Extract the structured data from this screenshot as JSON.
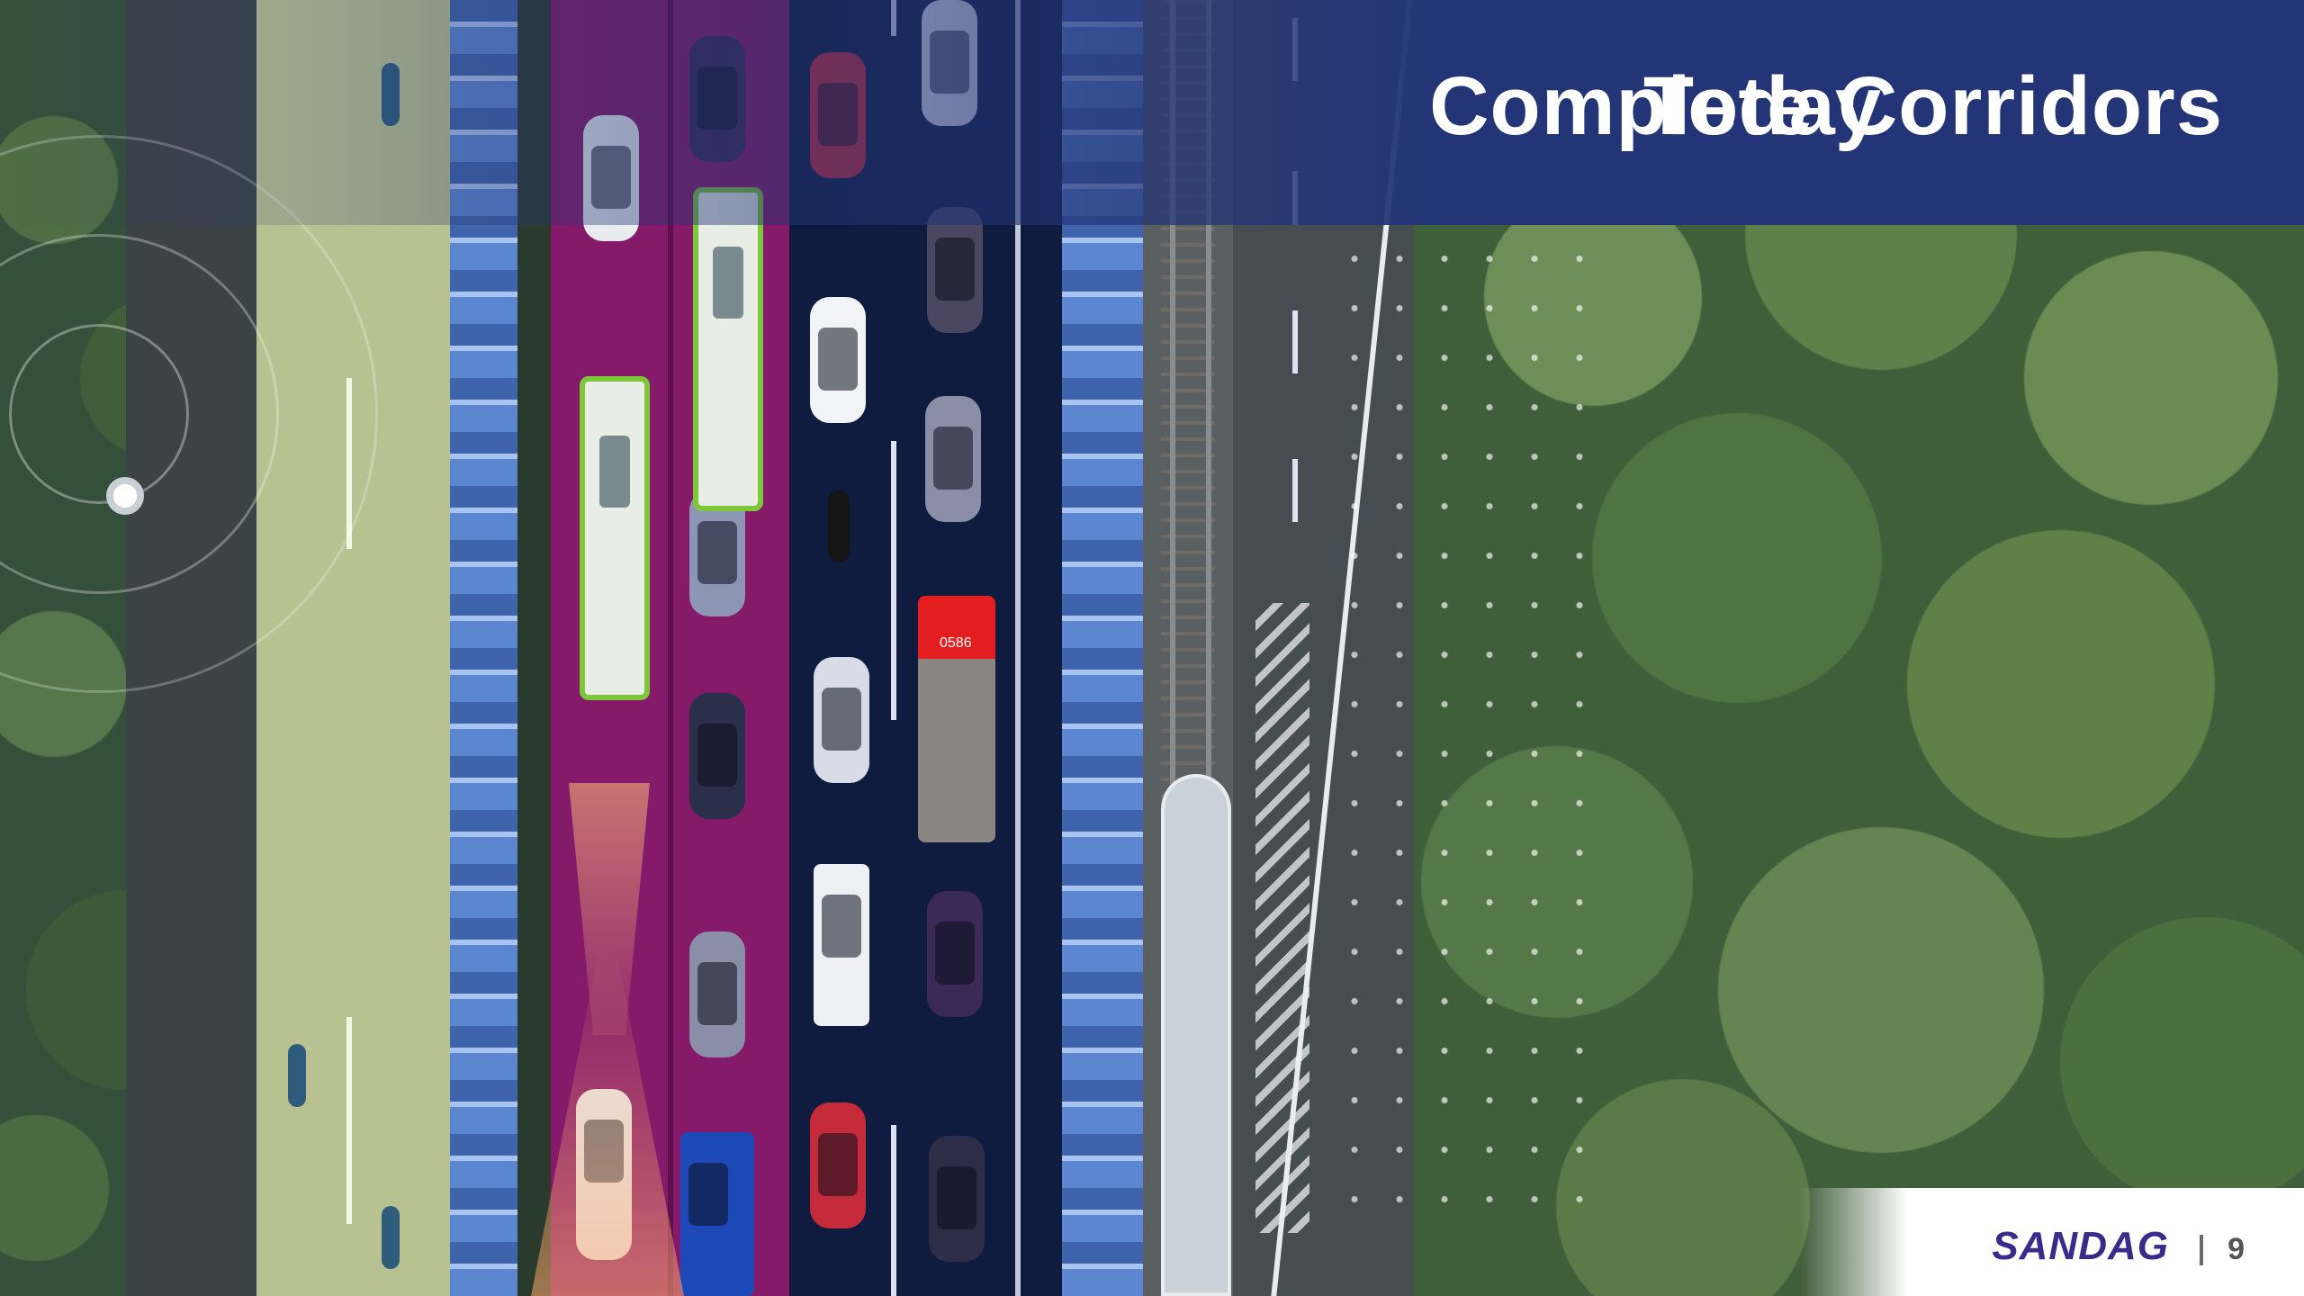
{
  "slide": {
    "title": "Complete Corridors",
    "title_overlay": "Today",
    "firetruck_label": "0586"
  },
  "footer": {
    "logo_text": "SANDAG",
    "page_number": "9"
  },
  "colors": {
    "header_band": "#233576",
    "logo": "#3a2a8c",
    "transit_lane": "#861a6a",
    "bus_accent": "#7ec63a"
  }
}
